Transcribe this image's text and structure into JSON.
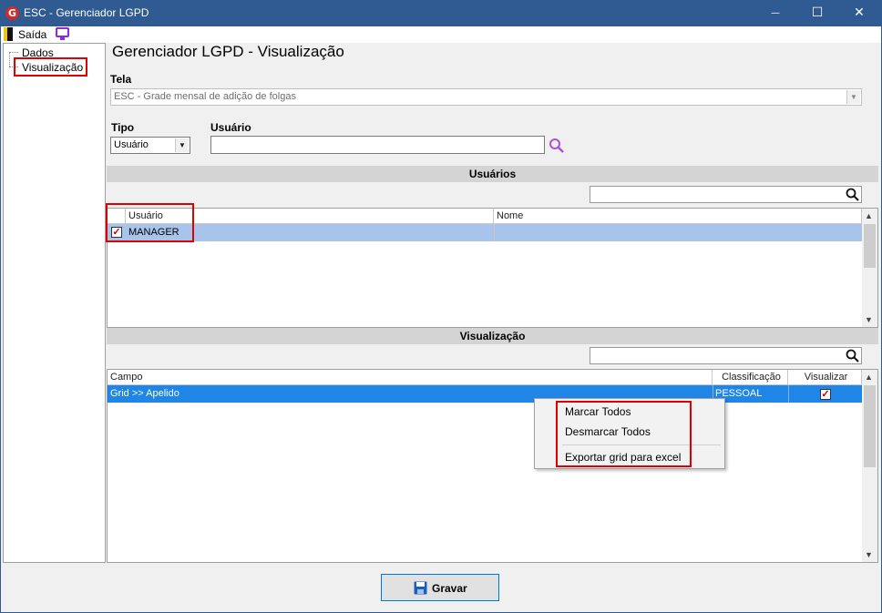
{
  "window": {
    "title": "ESC - Gerenciador LGPD",
    "logo_letter": "G",
    "minimize": "—",
    "maximize": "☐",
    "close": "✕"
  },
  "menubar": {
    "exit_label": "Saída"
  },
  "tree": {
    "items": [
      {
        "label": "Dados"
      },
      {
        "label": "Visualização"
      }
    ]
  },
  "page": {
    "title": "Gerenciador LGPD - Visualização"
  },
  "form": {
    "tela_label": "Tela",
    "tela_value": "ESC - Grade mensal de adição de folgas",
    "tipo_label": "Tipo",
    "tipo_value": "Usuário",
    "usuario_label": "Usuário",
    "usuario_value": ""
  },
  "users_section": {
    "title": "Usuários",
    "search_value": "",
    "columns": [
      "Usuário",
      "Nome"
    ],
    "rows": [
      {
        "checked": true,
        "usuario": "MANAGER",
        "nome": ""
      }
    ]
  },
  "view_section": {
    "title": "Visualização",
    "search_value": "",
    "columns": [
      "Campo",
      "Classificação",
      "Visualizar"
    ],
    "rows": [
      {
        "campo": "Grid >> Apelido",
        "classificacao": "PESSOAL",
        "visualizar": true
      }
    ]
  },
  "context_menu": {
    "items": [
      "Marcar Todos",
      "Desmarcar Todos",
      "Exportar grid para excel"
    ]
  },
  "footer": {
    "save_label": "Gravar"
  },
  "colors": {
    "titlebar": "#2f5a92",
    "selection": "#1f86e8",
    "highlight_red": "#e00000",
    "accent": "#8a2be2"
  }
}
